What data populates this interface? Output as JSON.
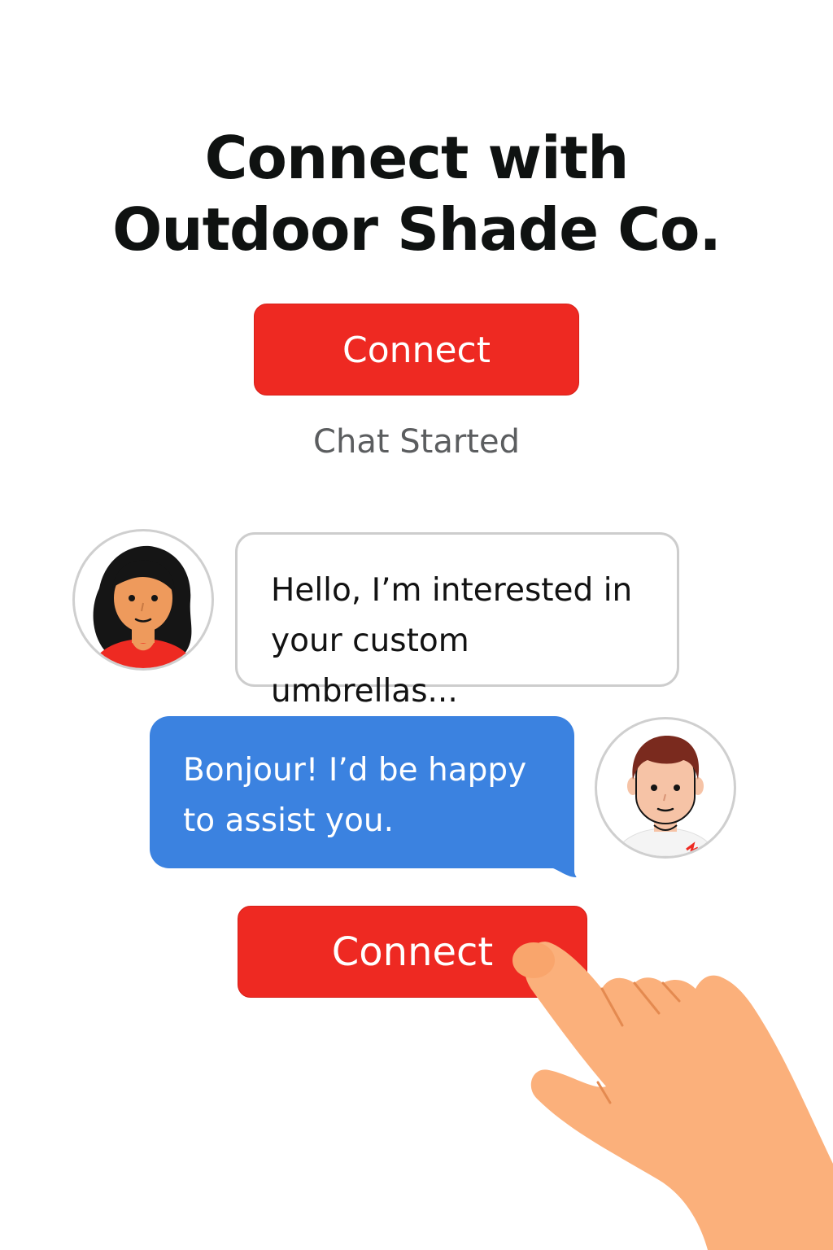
{
  "header": {
    "title_line1": "Connect with",
    "title_line2": "Outdoor Shade Co."
  },
  "primary_action": {
    "label": "Connect"
  },
  "status": {
    "text": "Chat Started"
  },
  "chat": {
    "messages": [
      {
        "sender": "customer",
        "lines": [
          "Hello, I’m interested in",
          "your custom umbrellas..."
        ]
      },
      {
        "sender": "agent",
        "lines": [
          "Bonjour! I’d be happy",
          "to assist you."
        ]
      }
    ]
  },
  "secondary_action": {
    "label": "Connect"
  },
  "colors": {
    "brand_red": "#ee2922",
    "agent_bubble_blue": "#3b82e0",
    "text_dark": "#0f1211",
    "status_gray": "#5b5d5f",
    "hand_skin": "#fbb07b"
  },
  "icons": {
    "customer_avatar": "woman-avatar-icon",
    "agent_avatar": "man-avatar-icon",
    "pointer": "pointing-hand-icon"
  }
}
